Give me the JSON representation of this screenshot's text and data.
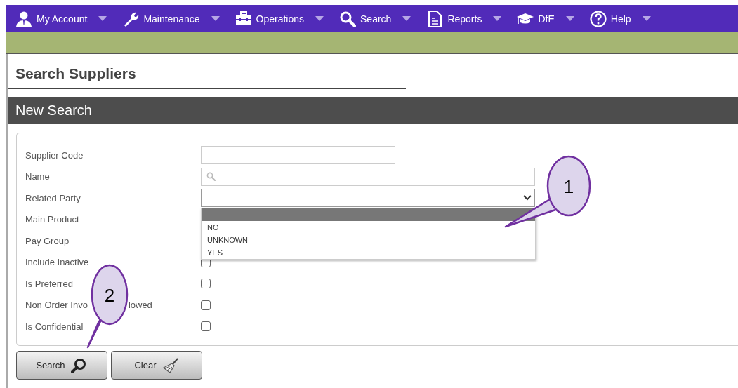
{
  "nav": [
    {
      "label": "My Account",
      "kind": "person"
    },
    {
      "label": "Maintenance",
      "kind": "wrench"
    },
    {
      "label": "Operations",
      "kind": "briefcase"
    },
    {
      "label": "Search",
      "kind": "search"
    },
    {
      "label": "Reports",
      "kind": "document"
    },
    {
      "label": "DfE",
      "kind": "cap"
    },
    {
      "label": "Help",
      "kind": "help"
    }
  ],
  "page_title": "Search Suppliers",
  "section_title": "New Search",
  "form": [
    {
      "label": "Supplier Code",
      "kind": "text"
    },
    {
      "label": "Name",
      "kind": "search"
    },
    {
      "label": "Related Party",
      "kind": "select",
      "expanded": true
    },
    {
      "label": "Main Product",
      "kind": "hidden"
    },
    {
      "label": "Pay Group",
      "kind": "hidden"
    },
    {
      "label": "Include Inactive",
      "kind": "checkbox",
      "checked": false
    },
    {
      "label": "Is Preferred",
      "kind": "checkbox",
      "checked": false
    },
    {
      "label": "Non Order Invo",
      "label_tail": "lowed",
      "kind": "checkbox",
      "checked": false
    },
    {
      "label": "Is Confidential",
      "kind": "checkbox",
      "checked": false
    }
  ],
  "dropdown": {
    "blank_option_selected": true,
    "options": [
      {
        "label": "NO",
        "selected": false
      },
      {
        "label": "UNKNOWN",
        "selected": false
      },
      {
        "label": "YES",
        "selected": false
      }
    ]
  },
  "buttons": [
    {
      "label": "Search",
      "kind": "search"
    },
    {
      "label": "Clear",
      "kind": "clear"
    }
  ],
  "callouts": [
    {
      "label": "1"
    },
    {
      "label": "2"
    }
  ]
}
